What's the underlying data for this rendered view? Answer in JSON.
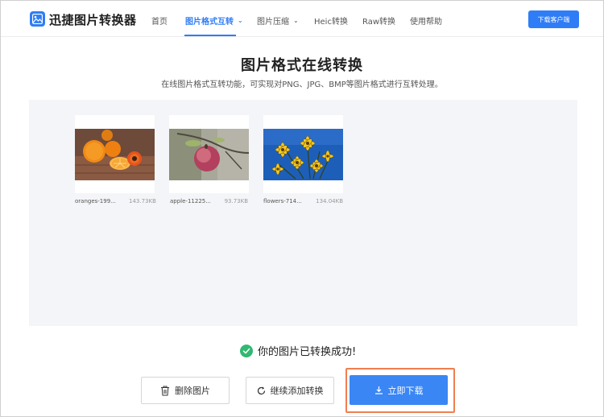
{
  "header": {
    "brand": "迅捷图片转换器",
    "nav": [
      {
        "label": "首页"
      },
      {
        "label": "图片格式互转",
        "chevron": "⌄",
        "active": true
      },
      {
        "label": "图片压缩",
        "chevron": "⌄"
      },
      {
        "label": "Heic转换"
      },
      {
        "label": "Raw转换"
      },
      {
        "label": "使用帮助"
      }
    ],
    "download_client": "下载客户端"
  },
  "main": {
    "title": "图片格式在线转换",
    "subtitle": "在线图片格式互转功能，可实现对PNG、JPG、BMP等图片格式进行互转处理。"
  },
  "files": [
    {
      "name": "oranges-199...",
      "size": "143.73KB",
      "image": "oranges"
    },
    {
      "name": "apple-11225...",
      "size": "93.73KB",
      "image": "apple"
    },
    {
      "name": "flowers-714...",
      "size": "134.04KB",
      "image": "flowers"
    }
  ],
  "status": {
    "message": "你的图片已转换成功!"
  },
  "actions": {
    "delete": "删除图片",
    "continue": "继续添加转换",
    "download": "立即下载"
  },
  "colors": {
    "accent": "#2f7df6",
    "success": "#31b871",
    "highlight": "#f07f4f"
  }
}
